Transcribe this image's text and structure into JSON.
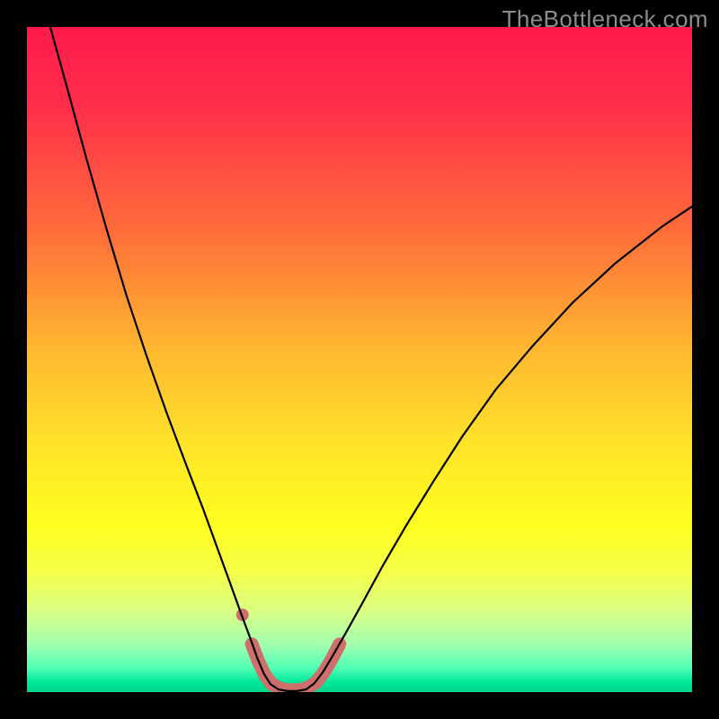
{
  "watermark": "TheBottleneck.com",
  "chart_data": {
    "type": "line",
    "title": "",
    "xlabel": "",
    "ylabel": "",
    "xlim": [
      0,
      100
    ],
    "ylim": [
      0,
      100
    ],
    "grid": false,
    "legend": false,
    "background_gradient": {
      "stops": [
        {
          "pos": 0.0,
          "color": "#ff1a4b"
        },
        {
          "pos": 0.12,
          "color": "#ff2e4a"
        },
        {
          "pos": 0.3,
          "color": "#ff6a3a"
        },
        {
          "pos": 0.48,
          "color": "#ffb631"
        },
        {
          "pos": 0.62,
          "color": "#ffe12a"
        },
        {
          "pos": 0.75,
          "color": "#ffff1f"
        },
        {
          "pos": 0.82,
          "color": "#f5ff4a"
        },
        {
          "pos": 0.88,
          "color": "#d9ff86"
        },
        {
          "pos": 0.93,
          "color": "#a0ffb0"
        },
        {
          "pos": 0.965,
          "color": "#4dffb5"
        },
        {
          "pos": 0.985,
          "color": "#00e89a"
        },
        {
          "pos": 1.0,
          "color": "#00d68a"
        }
      ]
    },
    "series": [
      {
        "name": "bottleneck-curve",
        "stroke": "#000000",
        "stroke_width": 2.2,
        "points": [
          {
            "x": 3.5,
            "y": 100.0
          },
          {
            "x": 6.0,
            "y": 91.0
          },
          {
            "x": 9.0,
            "y": 80.0
          },
          {
            "x": 12.0,
            "y": 69.5
          },
          {
            "x": 15.0,
            "y": 59.5
          },
          {
            "x": 18.0,
            "y": 50.5
          },
          {
            "x": 21.0,
            "y": 42.0
          },
          {
            "x": 24.0,
            "y": 34.0
          },
          {
            "x": 26.5,
            "y": 27.5
          },
          {
            "x": 28.5,
            "y": 22.0
          },
          {
            "x": 30.5,
            "y": 16.5
          },
          {
            "x": 32.3,
            "y": 11.5
          },
          {
            "x": 33.5,
            "y": 8.3
          },
          {
            "x": 34.6,
            "y": 5.2
          },
          {
            "x": 35.6,
            "y": 2.8
          },
          {
            "x": 36.6,
            "y": 1.2
          },
          {
            "x": 37.8,
            "y": 0.4
          },
          {
            "x": 39.2,
            "y": 0.15
          },
          {
            "x": 40.6,
            "y": 0.15
          },
          {
            "x": 42.0,
            "y": 0.4
          },
          {
            "x": 43.2,
            "y": 1.3
          },
          {
            "x": 44.5,
            "y": 3.0
          },
          {
            "x": 46.0,
            "y": 5.5
          },
          {
            "x": 48.0,
            "y": 9.0
          },
          {
            "x": 50.5,
            "y": 13.5
          },
          {
            "x": 53.5,
            "y": 19.0
          },
          {
            "x": 57.0,
            "y": 25.0
          },
          {
            "x": 61.0,
            "y": 31.5
          },
          {
            "x": 65.5,
            "y": 38.5
          },
          {
            "x": 70.5,
            "y": 45.5
          },
          {
            "x": 76.0,
            "y": 52.0
          },
          {
            "x": 82.0,
            "y": 58.5
          },
          {
            "x": 88.5,
            "y": 64.5
          },
          {
            "x": 95.5,
            "y": 70.0
          },
          {
            "x": 100.0,
            "y": 73.0
          }
        ]
      },
      {
        "name": "highlight-band",
        "stroke": "#cf6f6c",
        "stroke_width": 15,
        "linecap": "round",
        "points": [
          {
            "x": 33.8,
            "y": 7.2
          },
          {
            "x": 34.8,
            "y": 4.6
          },
          {
            "x": 35.8,
            "y": 2.5
          },
          {
            "x": 36.8,
            "y": 1.2
          },
          {
            "x": 38.0,
            "y": 0.55
          },
          {
            "x": 39.4,
            "y": 0.28
          },
          {
            "x": 40.8,
            "y": 0.3
          },
          {
            "x": 42.2,
            "y": 0.65
          },
          {
            "x": 43.4,
            "y": 1.4
          },
          {
            "x": 44.6,
            "y": 2.9
          },
          {
            "x": 45.8,
            "y": 4.9
          },
          {
            "x": 47.0,
            "y": 7.2
          }
        ]
      },
      {
        "name": "highlight-dot",
        "type": "scatter",
        "fill": "#cf6f6c",
        "radius": 7,
        "points": [
          {
            "x": 32.4,
            "y": 11.6
          }
        ]
      }
    ]
  }
}
